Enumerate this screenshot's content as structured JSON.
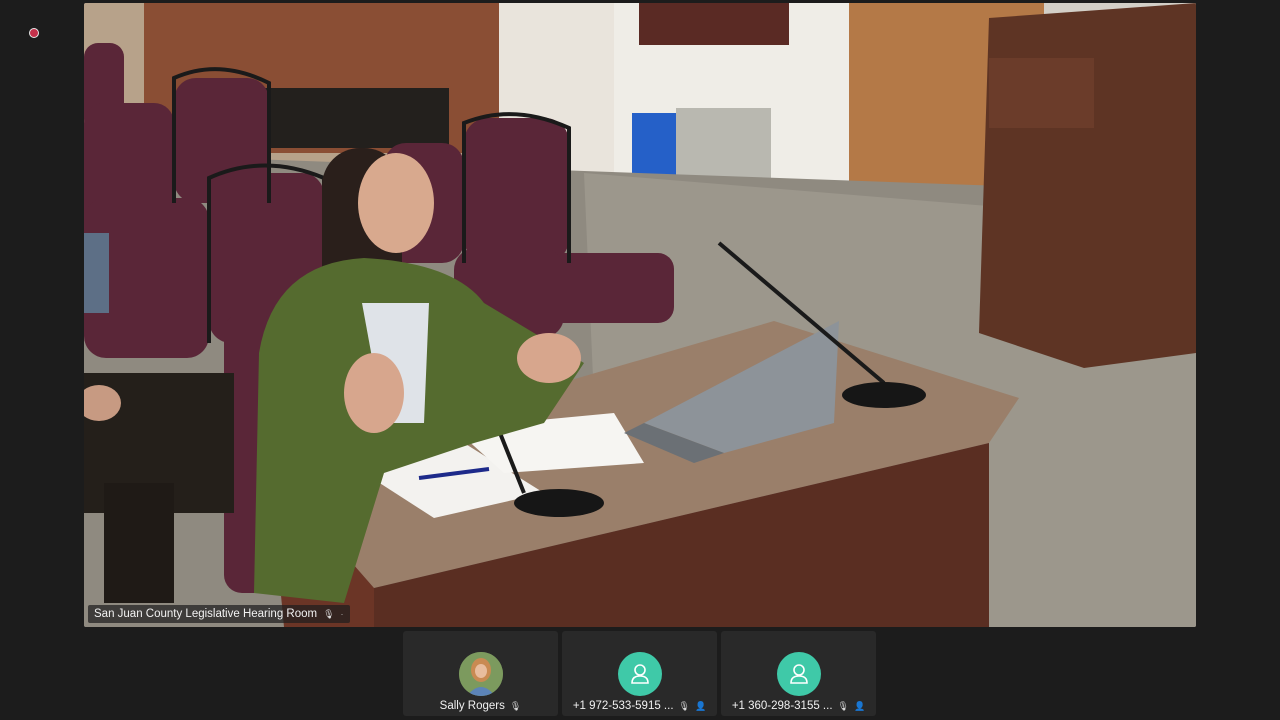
{
  "colors": {
    "background": "#1c1c1c",
    "tile_background": "#292929",
    "avatar_teal": "#3fc9a8",
    "recording_red": "#c4314b"
  },
  "main_video": {
    "participant_name": "San Juan County Legislative Hearing Room",
    "mic_icon": "microphone-icon",
    "more_icon": "more-icon"
  },
  "participants": [
    {
      "name": "Sally Rogers",
      "avatar": "photo",
      "mic_icon": "mic-muted-icon"
    },
    {
      "name": "+1 972-533-5915 ...",
      "avatar": "generic-person-icon",
      "mic_icon": "mic-muted-icon",
      "extra_icon": "phone-user-icon"
    },
    {
      "name": "+1 360-298-3155 ...",
      "avatar": "generic-person-icon",
      "mic_icon": "mic-muted-icon",
      "extra_icon": "phone-user-icon"
    }
  ]
}
